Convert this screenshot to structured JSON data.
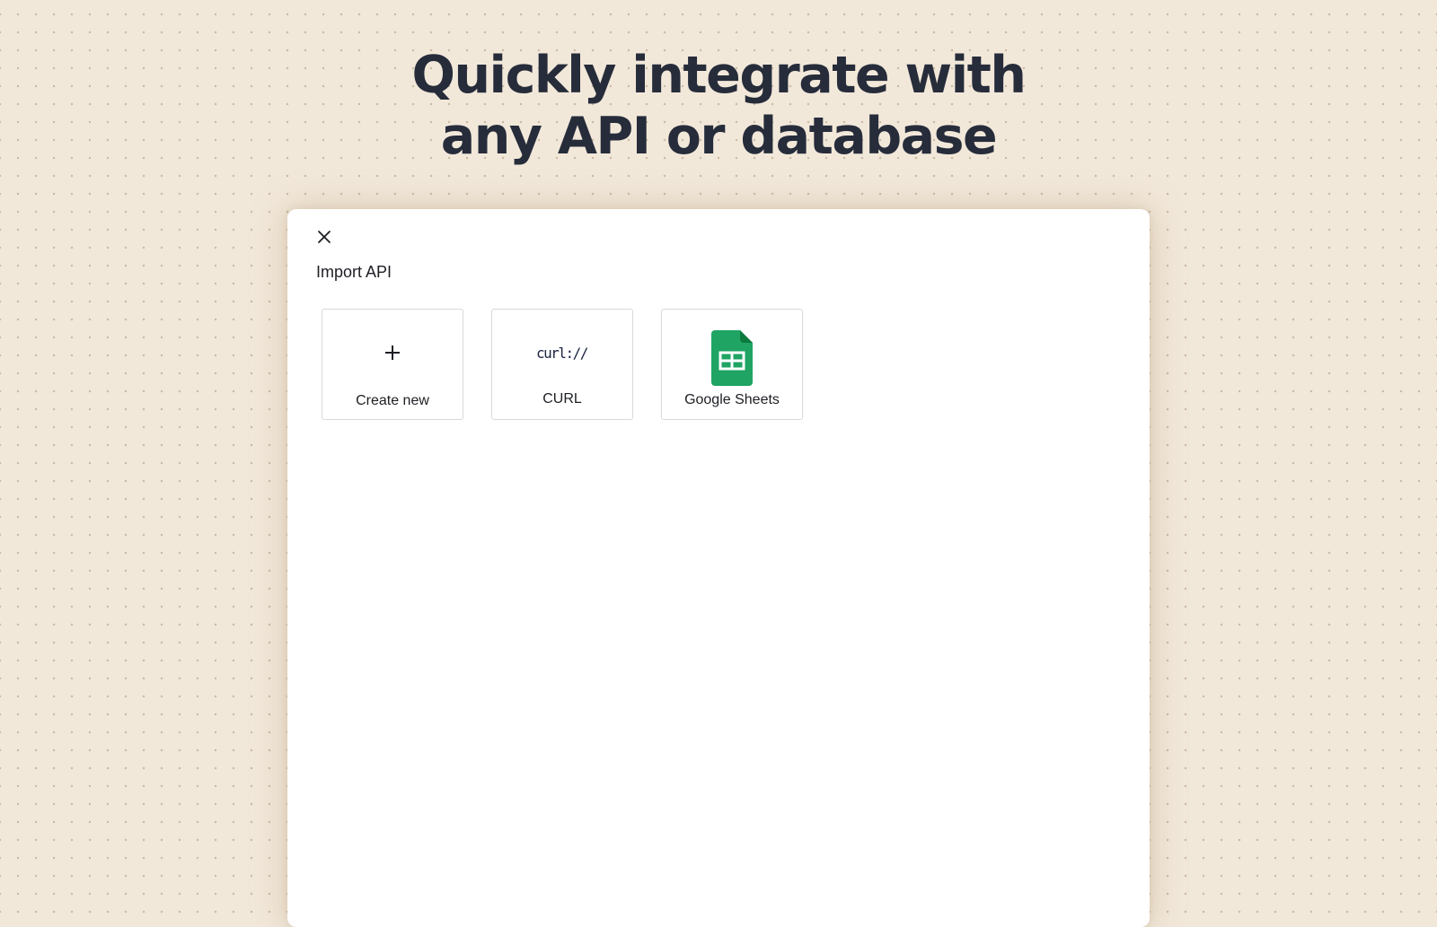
{
  "hero": {
    "line1": "Quickly integrate with",
    "line2": "any API or database"
  },
  "modal": {
    "title": "Import API",
    "close_icon": "close-icon"
  },
  "cards": [
    {
      "label": "Create new",
      "icon": "plus-icon"
    },
    {
      "label": "CURL",
      "icon": "curl-logo"
    },
    {
      "label": "Google Sheets",
      "icon": "google-sheets-icon"
    }
  ],
  "logos": {
    "curl_text": "curl://"
  },
  "colors": {
    "background": "#f2e8da",
    "heading": "#262c3a",
    "sheets_green": "#1fa463",
    "sheets_fold": "#0d7a3e",
    "curl_text": "#1a2340"
  }
}
